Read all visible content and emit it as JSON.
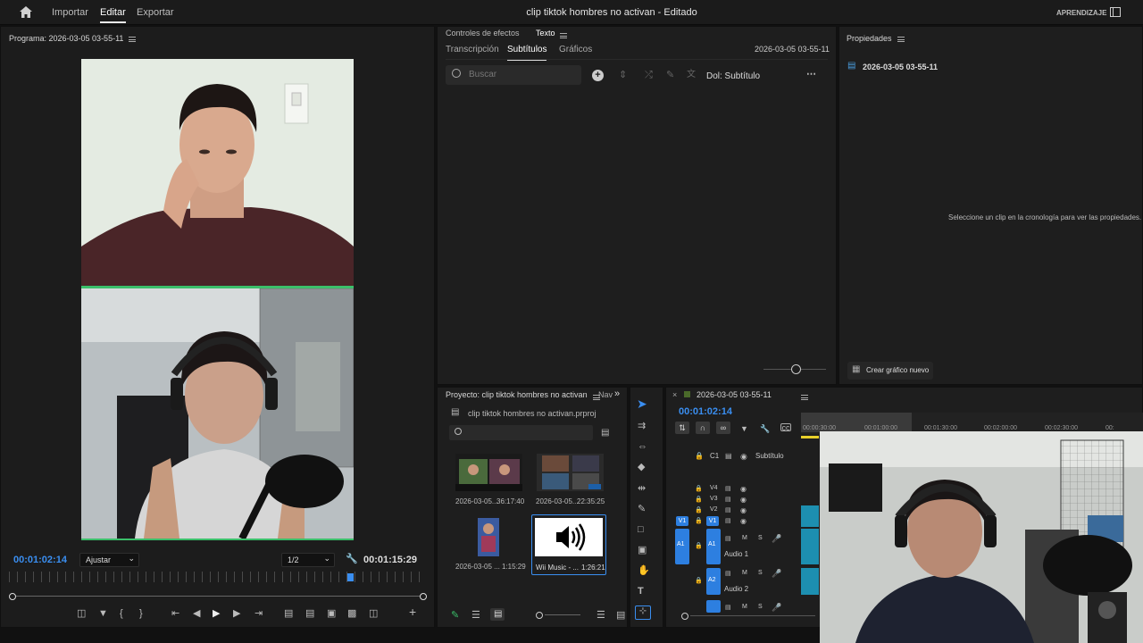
{
  "topbar": {
    "home_icon": "home-icon",
    "menu": [
      {
        "label": "Importar",
        "active": false
      },
      {
        "label": "Editar",
        "active": true
      },
      {
        "label": "Exportar",
        "active": false
      }
    ],
    "title": "clip tiktok hombres no activan - Editado",
    "learning": "APRENDIZAJE",
    "workspace_icon": "workspace-icon"
  },
  "program": {
    "title": "Programa: 2026-03-05 03-55-11",
    "timecode": "00:01:02:14",
    "fit": "Ajustar",
    "resolution": "1/2",
    "duration": "00:01:15:29",
    "playhead": 0.8
  },
  "effects": {
    "top_tabs": [
      {
        "label": "Controles de efectos",
        "active": false
      },
      {
        "label": "Texto",
        "active": true
      }
    ],
    "tabs": [
      {
        "label": "Transcripción",
        "active": false
      },
      {
        "label": "Subtítulos",
        "active": true
      },
      {
        "label": "Gráficos",
        "active": false
      }
    ],
    "sequence": "2026-03-05 03-55-11",
    "search_placeholder": "Buscar",
    "track": "Dol: Subtítulo"
  },
  "properties": {
    "title": "Propiedades",
    "sequence": "2026-03-05 03-55-11",
    "hint": "Seleccione un clip en la cronología para ver las propiedades.",
    "create_button": "Crear gráfico nuevo"
  },
  "project": {
    "title": "Proyecto: clip tiktok hombres no activan",
    "nav": "Nav",
    "file": "clip tiktok hombres no activan.prproj",
    "items": [
      {
        "name": "2026-03-05...",
        "duration": "36:17:40"
      },
      {
        "name": "2026-03-05...",
        "duration": "22:35:25"
      },
      {
        "name": "2026-03-05 ...",
        "duration": "1:15:29"
      },
      {
        "name": "Wii Music - ...",
        "duration": "1:26:21"
      }
    ]
  },
  "timeline": {
    "title": "2026-03-05 03-55-11",
    "timecode": "00:01:02:14",
    "ruler": [
      "00:00:30:00",
      "00:01:00:00",
      "00:01:30:00",
      "00:02:00:00",
      "00:02:30:00",
      "00:"
    ],
    "caption_track": "C1",
    "caption_label": "Subtítulo",
    "video_tracks": [
      "V4",
      "V3",
      "V2",
      "V1"
    ],
    "src_v": "V1",
    "src_a": "A1",
    "audio_tracks": [
      {
        "id": "A1",
        "name": "Audio 1"
      },
      {
        "id": "A2",
        "name": "Audio 2"
      }
    ],
    "mute": "M",
    "solo": "S"
  },
  "colors": {
    "accent": "#2d7fe0",
    "panel_bg": "#1e1e1e",
    "app_bg": "#111111",
    "clip_teal": "#1d8fb0"
  }
}
